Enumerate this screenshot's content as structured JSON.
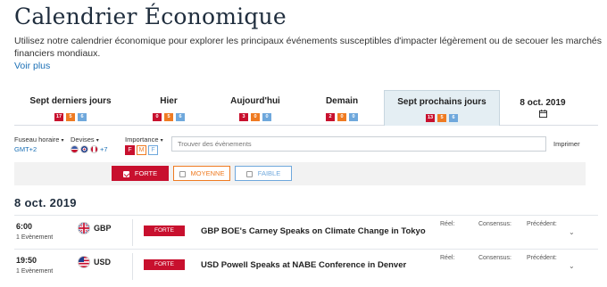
{
  "page": {
    "title": "Calendrier Économique",
    "description": "Utilisez notre calendrier économique pour explorer les principaux événements susceptibles d'impacter légèrement ou de secouer les marchés financiers mondiaux.",
    "more_link": "Voir plus"
  },
  "tabs": [
    {
      "label": "Sept derniers jours",
      "high": "17",
      "medium": "5",
      "low": "6",
      "active": false
    },
    {
      "label": "Hier",
      "high": "0",
      "medium": "5",
      "low": "6",
      "active": false
    },
    {
      "label": "Aujourd'hui",
      "high": "3",
      "medium": "0",
      "low": "0",
      "active": false
    },
    {
      "label": "Demain",
      "high": "2",
      "medium": "0",
      "low": "0",
      "active": false
    },
    {
      "label": "Sept prochains jours",
      "high": "13",
      "medium": "5",
      "low": "6",
      "active": true
    },
    {
      "label": "8 oct. 2019",
      "icon": "calendar-icon",
      "active": false
    }
  ],
  "filters": {
    "timezone_label": "Fuseau horaire",
    "timezone_value": "GMT+2",
    "currencies_label": "Devises",
    "currencies_more": "+7",
    "importance_label": "Importance",
    "importance_buttons": [
      "F",
      "M",
      "F"
    ],
    "search_placeholder": "Trouver des évènements",
    "print_label": "Imprimer"
  },
  "importance_bar": {
    "forte": "FORTE",
    "moyenne": "MOYENNE",
    "faible": "FAIBLE"
  },
  "day": {
    "date": "8 oct. 2019",
    "events": [
      {
        "time": "6:00",
        "count": "1 Evènement",
        "currency": "GBP",
        "impact": "FORTE",
        "title": "GBP BOE's Carney Speaks on Climate Change in Tokyo",
        "actual_label": "Réel:",
        "consensus_label": "Consensus:",
        "previous_label": "Précédent:"
      },
      {
        "time": "19:50",
        "count": "1 Evènement",
        "currency": "USD",
        "impact": "FORTE",
        "title": "USD Powell Speaks at NABE Conference in Denver",
        "actual_label": "Réel:",
        "consensus_label": "Consensus:",
        "previous_label": "Précédent:"
      }
    ]
  },
  "colors": {
    "high": "#c8102e",
    "medium": "#ef7b22",
    "low": "#6fa8dc",
    "link": "#1a6fb5",
    "active_tab": "#e4eef3"
  }
}
